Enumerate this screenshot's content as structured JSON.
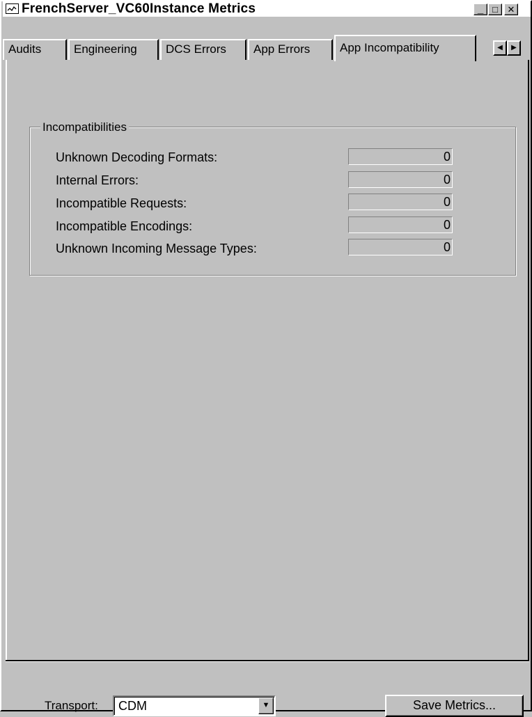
{
  "window": {
    "title": "FrenchServer_VC60Instance Metrics",
    "icon": "chart-line-icon",
    "controls": {
      "minimize": "_",
      "maximize": "□",
      "close": "✕"
    }
  },
  "tabs": [
    {
      "label": "Audits",
      "active": false
    },
    {
      "label": "Engineering",
      "active": false
    },
    {
      "label": "DCS Errors",
      "active": false
    },
    {
      "label": "App Errors",
      "active": false
    },
    {
      "label": "App Incompatibility",
      "active": true
    }
  ],
  "tab_scroll": {
    "left": "◀",
    "right": "▶"
  },
  "incompatibilities": {
    "group_label": "Incompatibilities",
    "rows": [
      {
        "label": "Unknown Decoding Formats:",
        "value": "0"
      },
      {
        "label": "Internal Errors:",
        "value": "0"
      },
      {
        "label": "Incompatible Requests:",
        "value": "0"
      },
      {
        "label": "Incompatible Encodings:",
        "value": "0"
      },
      {
        "label": "Unknown Incoming Message Types:",
        "value": "0"
      }
    ]
  },
  "footer": {
    "transport_label": "Transport:",
    "transport_value": "CDM",
    "dropdown_arrow": "▼",
    "save_button": "Save Metrics..."
  },
  "colors": {
    "face": "#c0c0c0",
    "highlight": "#ffffff",
    "shadow": "#808080",
    "dark": "#000000"
  }
}
